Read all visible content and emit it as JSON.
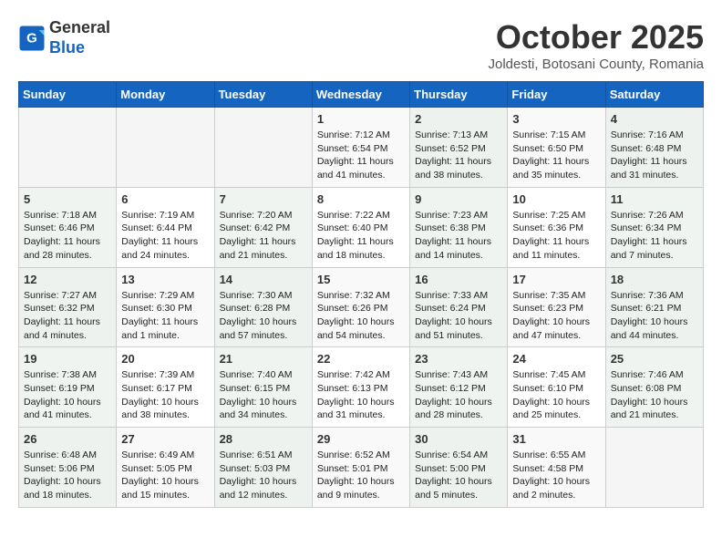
{
  "header": {
    "logo_line1": "General",
    "logo_line2": "Blue",
    "month": "October 2025",
    "location": "Joldesti, Botosani County, Romania"
  },
  "weekdays": [
    "Sunday",
    "Monday",
    "Tuesday",
    "Wednesday",
    "Thursday",
    "Friday",
    "Saturday"
  ],
  "weeks": [
    [
      {
        "day": "",
        "info": ""
      },
      {
        "day": "",
        "info": ""
      },
      {
        "day": "",
        "info": ""
      },
      {
        "day": "1",
        "info": "Sunrise: 7:12 AM\nSunset: 6:54 PM\nDaylight: 11 hours and 41 minutes."
      },
      {
        "day": "2",
        "info": "Sunrise: 7:13 AM\nSunset: 6:52 PM\nDaylight: 11 hours and 38 minutes."
      },
      {
        "day": "3",
        "info": "Sunrise: 7:15 AM\nSunset: 6:50 PM\nDaylight: 11 hours and 35 minutes."
      },
      {
        "day": "4",
        "info": "Sunrise: 7:16 AM\nSunset: 6:48 PM\nDaylight: 11 hours and 31 minutes."
      }
    ],
    [
      {
        "day": "5",
        "info": "Sunrise: 7:18 AM\nSunset: 6:46 PM\nDaylight: 11 hours and 28 minutes."
      },
      {
        "day": "6",
        "info": "Sunrise: 7:19 AM\nSunset: 6:44 PM\nDaylight: 11 hours and 24 minutes."
      },
      {
        "day": "7",
        "info": "Sunrise: 7:20 AM\nSunset: 6:42 PM\nDaylight: 11 hours and 21 minutes."
      },
      {
        "day": "8",
        "info": "Sunrise: 7:22 AM\nSunset: 6:40 PM\nDaylight: 11 hours and 18 minutes."
      },
      {
        "day": "9",
        "info": "Sunrise: 7:23 AM\nSunset: 6:38 PM\nDaylight: 11 hours and 14 minutes."
      },
      {
        "day": "10",
        "info": "Sunrise: 7:25 AM\nSunset: 6:36 PM\nDaylight: 11 hours and 11 minutes."
      },
      {
        "day": "11",
        "info": "Sunrise: 7:26 AM\nSunset: 6:34 PM\nDaylight: 11 hours and 7 minutes."
      }
    ],
    [
      {
        "day": "12",
        "info": "Sunrise: 7:27 AM\nSunset: 6:32 PM\nDaylight: 11 hours and 4 minutes."
      },
      {
        "day": "13",
        "info": "Sunrise: 7:29 AM\nSunset: 6:30 PM\nDaylight: 11 hours and 1 minute."
      },
      {
        "day": "14",
        "info": "Sunrise: 7:30 AM\nSunset: 6:28 PM\nDaylight: 10 hours and 57 minutes."
      },
      {
        "day": "15",
        "info": "Sunrise: 7:32 AM\nSunset: 6:26 PM\nDaylight: 10 hours and 54 minutes."
      },
      {
        "day": "16",
        "info": "Sunrise: 7:33 AM\nSunset: 6:24 PM\nDaylight: 10 hours and 51 minutes."
      },
      {
        "day": "17",
        "info": "Sunrise: 7:35 AM\nSunset: 6:23 PM\nDaylight: 10 hours and 47 minutes."
      },
      {
        "day": "18",
        "info": "Sunrise: 7:36 AM\nSunset: 6:21 PM\nDaylight: 10 hours and 44 minutes."
      }
    ],
    [
      {
        "day": "19",
        "info": "Sunrise: 7:38 AM\nSunset: 6:19 PM\nDaylight: 10 hours and 41 minutes."
      },
      {
        "day": "20",
        "info": "Sunrise: 7:39 AM\nSunset: 6:17 PM\nDaylight: 10 hours and 38 minutes."
      },
      {
        "day": "21",
        "info": "Sunrise: 7:40 AM\nSunset: 6:15 PM\nDaylight: 10 hours and 34 minutes."
      },
      {
        "day": "22",
        "info": "Sunrise: 7:42 AM\nSunset: 6:13 PM\nDaylight: 10 hours and 31 minutes."
      },
      {
        "day": "23",
        "info": "Sunrise: 7:43 AM\nSunset: 6:12 PM\nDaylight: 10 hours and 28 minutes."
      },
      {
        "day": "24",
        "info": "Sunrise: 7:45 AM\nSunset: 6:10 PM\nDaylight: 10 hours and 25 minutes."
      },
      {
        "day": "25",
        "info": "Sunrise: 7:46 AM\nSunset: 6:08 PM\nDaylight: 10 hours and 21 minutes."
      }
    ],
    [
      {
        "day": "26",
        "info": "Sunrise: 6:48 AM\nSunset: 5:06 PM\nDaylight: 10 hours and 18 minutes."
      },
      {
        "day": "27",
        "info": "Sunrise: 6:49 AM\nSunset: 5:05 PM\nDaylight: 10 hours and 15 minutes."
      },
      {
        "day": "28",
        "info": "Sunrise: 6:51 AM\nSunset: 5:03 PM\nDaylight: 10 hours and 12 minutes."
      },
      {
        "day": "29",
        "info": "Sunrise: 6:52 AM\nSunset: 5:01 PM\nDaylight: 10 hours and 9 minutes."
      },
      {
        "day": "30",
        "info": "Sunrise: 6:54 AM\nSunset: 5:00 PM\nDaylight: 10 hours and 5 minutes."
      },
      {
        "day": "31",
        "info": "Sunrise: 6:55 AM\nSunset: 4:58 PM\nDaylight: 10 hours and 2 minutes."
      },
      {
        "day": "",
        "info": ""
      }
    ]
  ]
}
